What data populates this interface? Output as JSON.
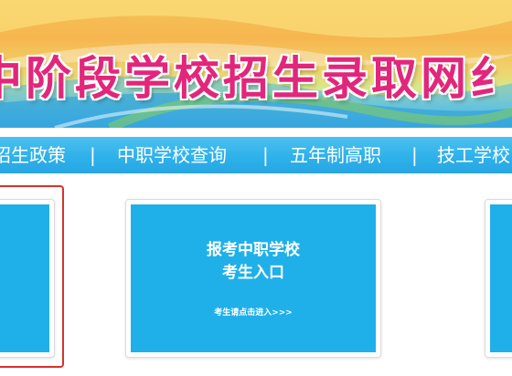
{
  "banner": {
    "title": "中阶段学校招生录取网纟"
  },
  "nav": {
    "items": [
      {
        "label": "招生政策"
      },
      {
        "label": "中职学校查询"
      },
      {
        "label": "五年制高职"
      },
      {
        "label": "技工学校"
      }
    ],
    "separator": "|"
  },
  "cards": {
    "center": {
      "title_line1": "报考中职学校",
      "title_line2": "考生入口",
      "subtitle": "考生请点击进入>>>"
    }
  },
  "colors": {
    "nav_bg": "#2fb1ea",
    "card_bg": "#1fb0ea",
    "title_color": "#e2267b",
    "highlight_border": "#d9322c"
  }
}
